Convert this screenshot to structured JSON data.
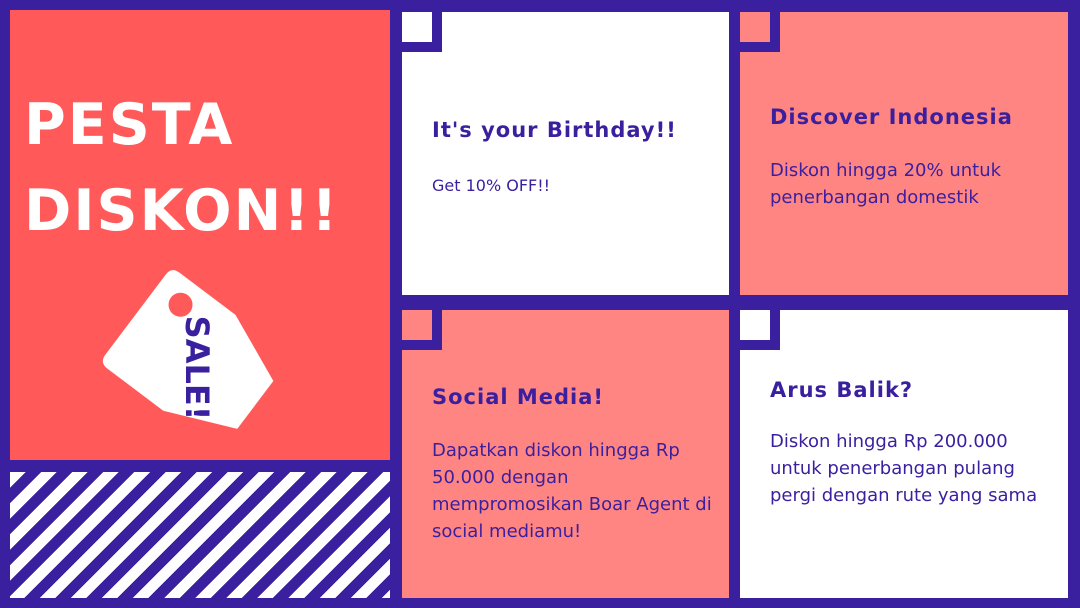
{
  "hero": {
    "title_line1": "PESTA",
    "title_line2": "DISKON!!",
    "tag_label": "SALE!",
    "tag_icon": "price-tag-icon"
  },
  "cards": [
    {
      "title": "It's your Birthday!!",
      "text": "Get 10% OFF!!"
    },
    {
      "title": "Discover Indonesia",
      "text": "Diskon hingga 20% untuk penerbangan domestik"
    },
    {
      "title": "Social Media!",
      "text": "Dapatkan diskon hingga Rp 50.000 dengan mempromosikan Boar Agent di social mediamu!"
    },
    {
      "title": "Arus Balik?",
      "text": "Diskon hingga Rp 200.000 untuk penerbangan pulang pergi dengan rute yang sama"
    }
  ],
  "colors": {
    "frame": "#3a1f9e",
    "hero_red": "#ff5a59",
    "card_pink": "#ff8583",
    "card_white": "#ffffff",
    "text_purple": "#3a1f9e"
  }
}
